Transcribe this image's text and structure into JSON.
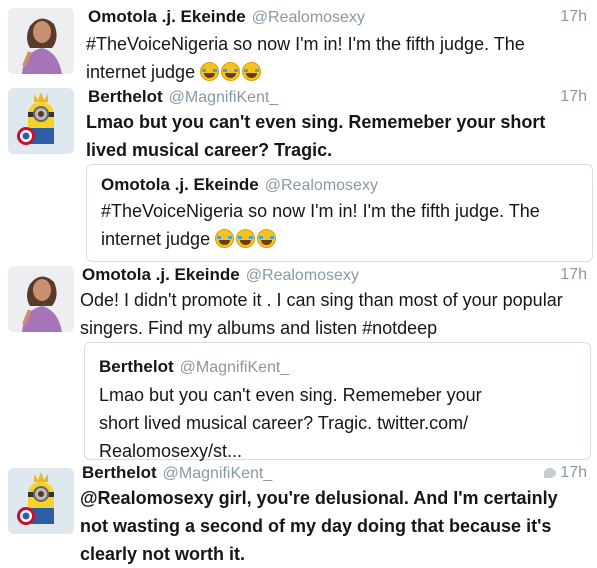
{
  "tweets": [
    {
      "name": "Omotola .j. Ekeinde",
      "handle": "@Realomosexy",
      "time": "17h",
      "text": "#TheVoiceNigeria so now I'm in! I'm the fifth judge. The internet judge",
      "emoji": [
        "face-with-tears-of-joy",
        "face-with-tears-of-joy",
        "face-with-tears-of-joy"
      ]
    },
    {
      "name": "Berthelot",
      "handle": "@MagnifiKent_",
      "time": "17h",
      "text": "Lmao but you can't even sing. Rememeber your short lived musical career? Tragic.",
      "quote": {
        "name": "Omotola .j. Ekeinde",
        "handle": "@Realomosexy",
        "text": "#TheVoiceNigeria so now I'm in! I'm the fifth judge. The internet judge",
        "emoji": [
          "face-with-tears-of-joy",
          "face-with-tears-of-joy",
          "face-with-tears-of-joy"
        ]
      }
    },
    {
      "name": "Omotola .j. Ekeinde",
      "handle": "@Realomosexy",
      "time": "17h",
      "text": "Ode! I didn't promote it . I can sing than most of your popular singers. Find my albums and listen #notdeep",
      "quote": {
        "name": "Berthelot",
        "handle": "@MagnifiKent_",
        "text": "Lmao but you can't even sing. Rememeber your short lived musical career? Tragic. twitter.com/ Realomosexy/st..."
      }
    },
    {
      "name": "Berthelot",
      "handle": "@MagnifiKent_",
      "time": "17h",
      "text": "@Realomosexy girl, you're delusional. And I'm certainly not wasting a second of my day doing that because it's clearly not worth it."
    }
  ],
  "colors": {
    "text": "#14171a",
    "secondary": "#8899a6",
    "border": "#d8dee3"
  }
}
